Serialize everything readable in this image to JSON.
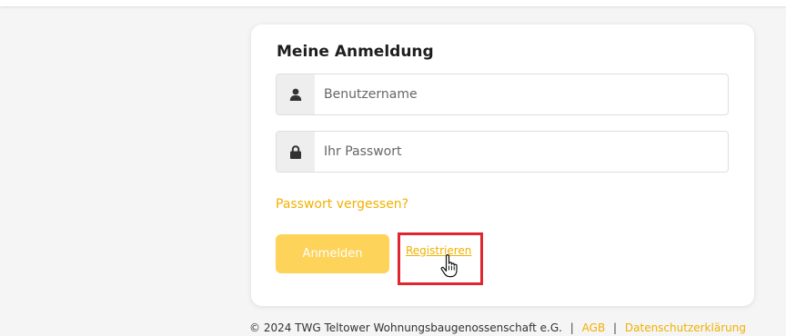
{
  "login": {
    "title": "Meine Anmeldung",
    "username_placeholder": "Benutzername",
    "username_value": "",
    "password_placeholder": "Ihr Passwort",
    "password_value": "",
    "forgot_label": "Passwort vergessen?",
    "login_label": "Anmelden",
    "register_label": "Registrieren",
    "user_icon": "user-icon",
    "lock_icon": "lock-icon"
  },
  "footer": {
    "copyright": "© 2024 TWG Teltower Wohnungsbaugenossenschaft e.G.",
    "separator": "|",
    "agb_label": "AGB",
    "privacy_label": "Datenschutzerklärung"
  },
  "colors": {
    "accent": "#f1b000",
    "button": "#fdd35a",
    "highlight": "#e0262f",
    "background": "#f5f5f5"
  }
}
